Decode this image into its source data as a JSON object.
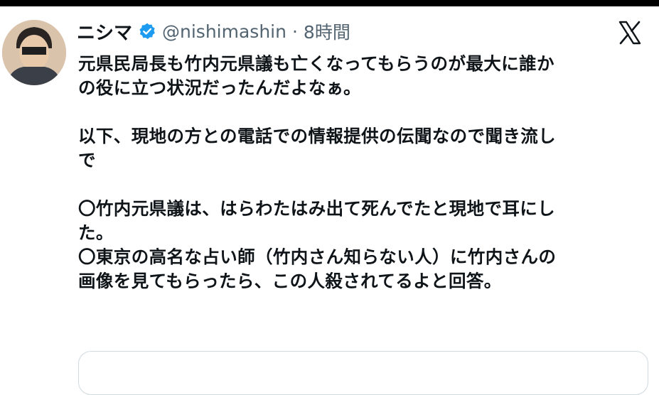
{
  "tweet": {
    "author": {
      "display_name": "ニシマ",
      "handle": "@nishimashin",
      "separator": "·",
      "time": "8時間",
      "verified": true
    },
    "lines": [
      "元県民局長も竹内元県議も亡くなってもらうのが最大に誰か",
      "の役に立つ状況だったんだよなぁ。",
      "",
      "以下、現地の方との電話での情報提供の伝聞なので聞き流し",
      "で",
      "",
      "〇竹内元県議は、はらわたはみ出て死んでたと現地で耳にし",
      "た。",
      "〇東京の高名な占い師（竹内さん知らない人）に竹内さんの",
      "画像を見てもらったら、この人殺されてるよと回答。"
    ]
  },
  "colors": {
    "text": "#0f1419",
    "secondary_text": "#536471",
    "verified_blue": "#1d9bf0",
    "card_border": "#cfd9de",
    "top_bar": "#000000"
  },
  "icons": {
    "verified": "verified-badge-icon",
    "platform": "x-logo-icon"
  }
}
